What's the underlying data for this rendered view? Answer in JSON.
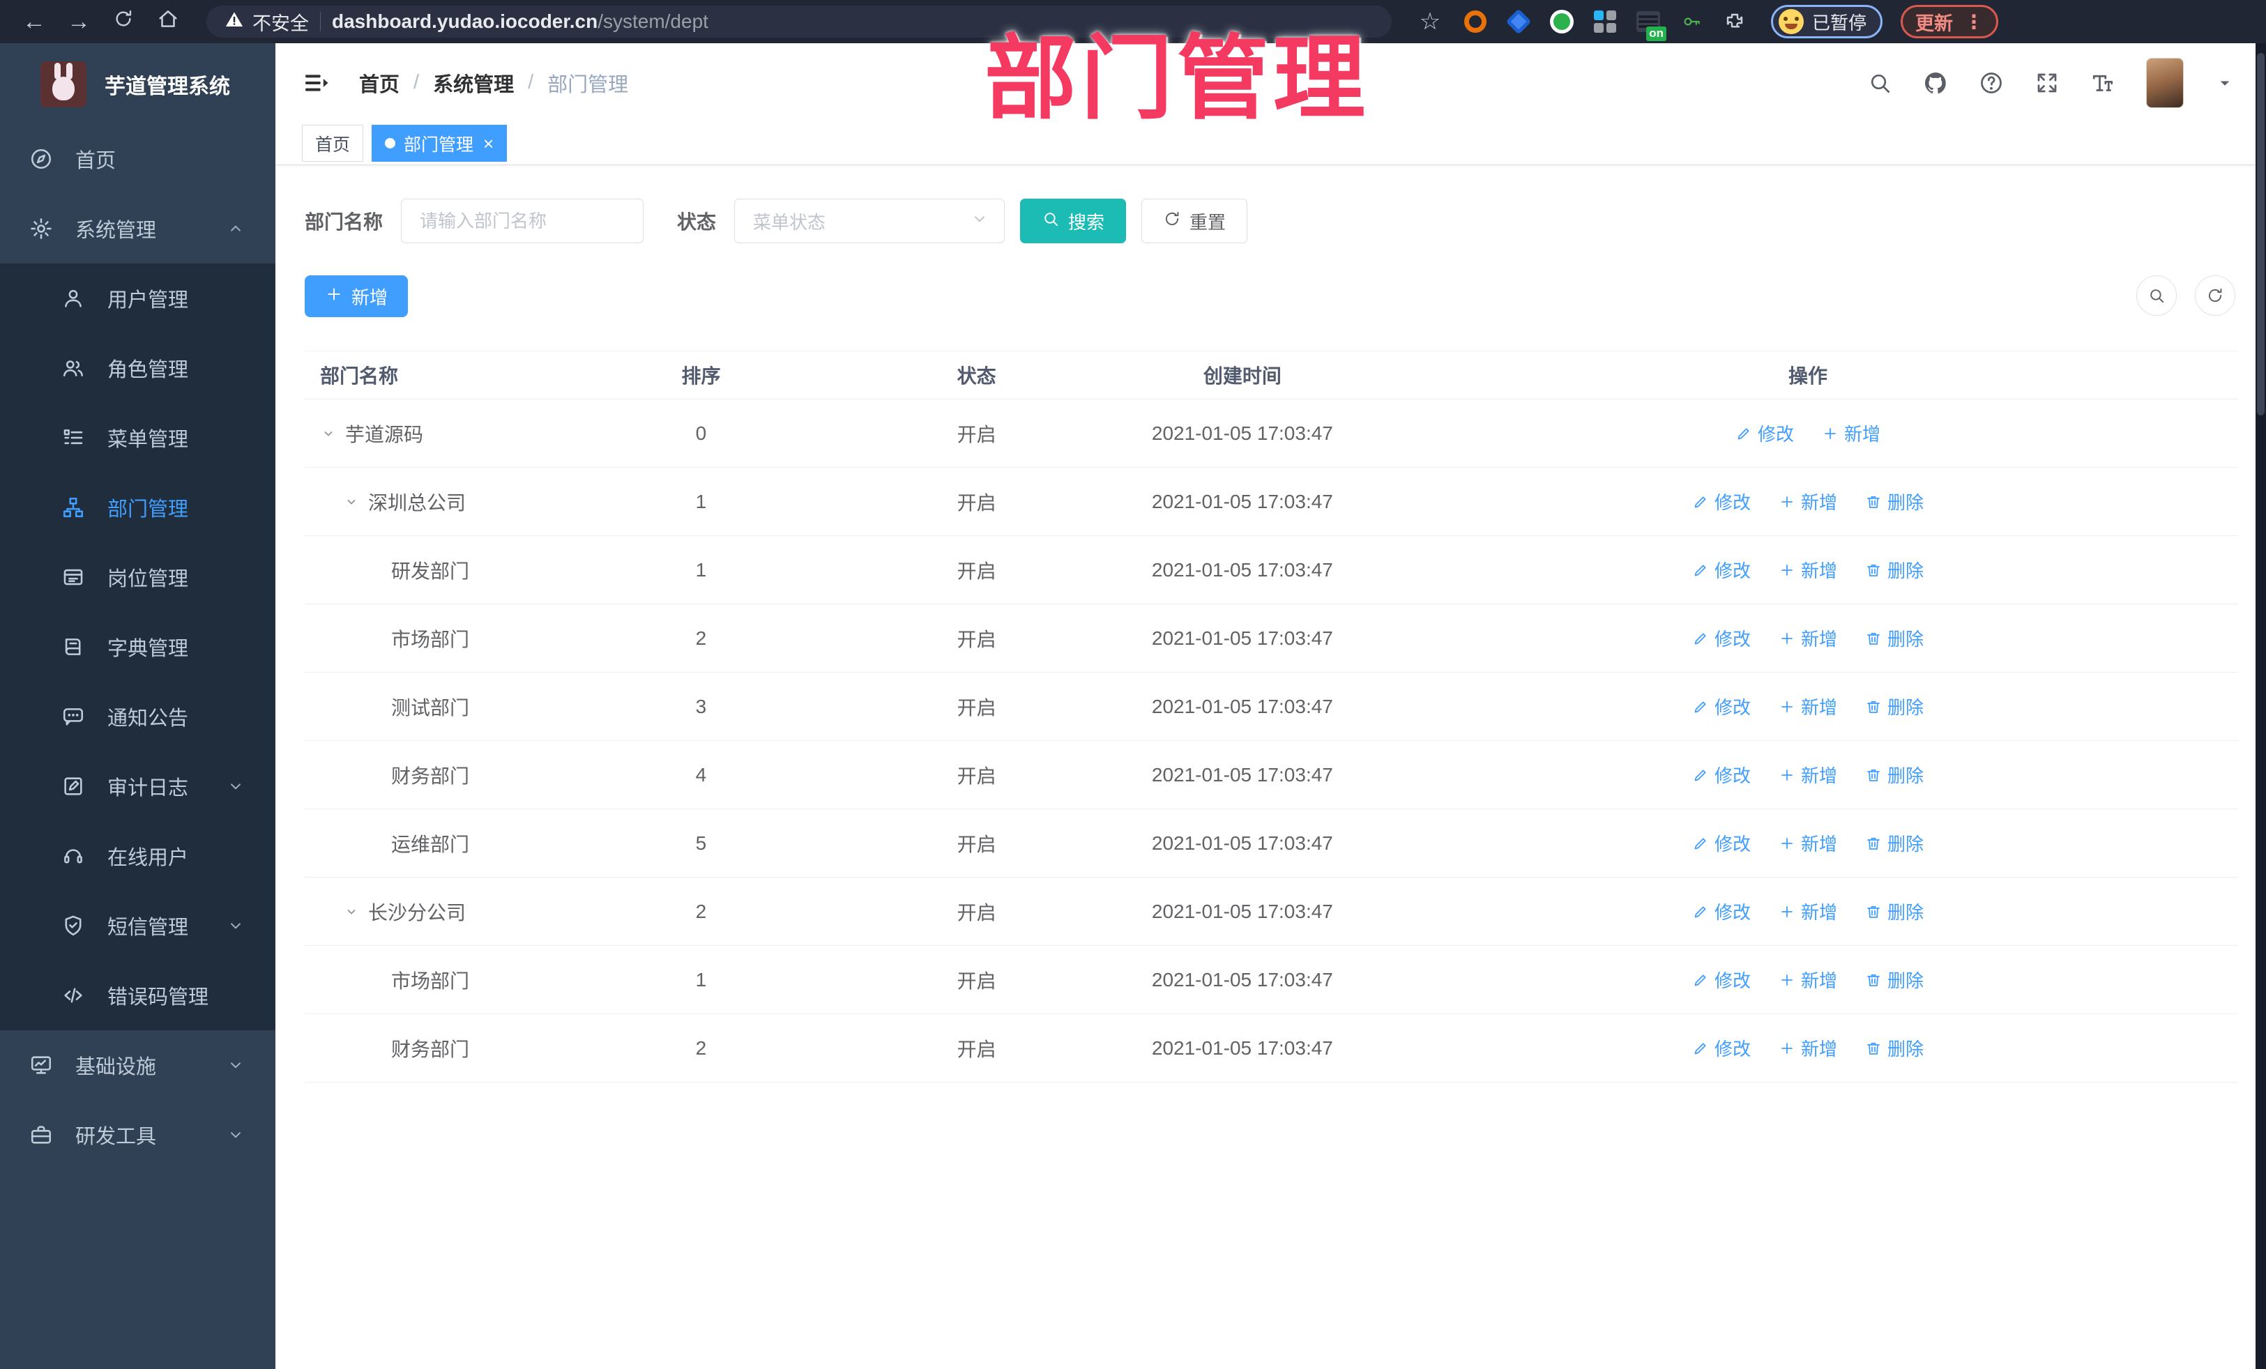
{
  "browser": {
    "security_label": "不安全",
    "url_host": "dashboard.yudao.iocoder.cn",
    "url_path": "/system/dept",
    "ext_badge": "on",
    "profile_label": "已暂停",
    "update_label": "更新",
    "update_menu_glyph": "⋮",
    "star_glyph": "☆",
    "back_glyph": "←",
    "forward_glyph": "→"
  },
  "watermark": "部门管理",
  "sidebar": {
    "title": "芋道管理系统",
    "items": [
      {
        "key": "home",
        "label": "首页",
        "icon": "guide",
        "level": 0
      },
      {
        "key": "system",
        "label": "系统管理",
        "icon": "gear",
        "level": 0,
        "chevron": "up"
      },
      {
        "key": "user",
        "label": "用户管理",
        "icon": "user",
        "level": 1
      },
      {
        "key": "role",
        "label": "角色管理",
        "icon": "users",
        "level": 1
      },
      {
        "key": "menu",
        "label": "菜单管理",
        "icon": "menu",
        "level": 1
      },
      {
        "key": "dept",
        "label": "部门管理",
        "icon": "dept",
        "level": 1,
        "active": true
      },
      {
        "key": "post",
        "label": "岗位管理",
        "icon": "post",
        "level": 1
      },
      {
        "key": "dict",
        "label": "字典管理",
        "icon": "dict",
        "level": 1
      },
      {
        "key": "notice",
        "label": "通知公告",
        "icon": "notice",
        "level": 1
      },
      {
        "key": "log",
        "label": "审计日志",
        "icon": "log",
        "level": 1,
        "chevron": "down"
      },
      {
        "key": "online",
        "label": "在线用户",
        "icon": "online",
        "level": 1
      },
      {
        "key": "sms",
        "label": "短信管理",
        "icon": "sms",
        "level": 1,
        "chevron": "down"
      },
      {
        "key": "errcode",
        "label": "错误码管理",
        "icon": "code",
        "level": 1
      },
      {
        "key": "infra",
        "label": "基础设施",
        "icon": "infra",
        "level": 0,
        "chevron": "down"
      },
      {
        "key": "tools",
        "label": "研发工具",
        "icon": "tools",
        "level": 0,
        "chevron": "down"
      }
    ]
  },
  "header": {
    "breadcrumb": [
      "首页",
      "系统管理",
      "部门管理"
    ],
    "icon_names": [
      "search",
      "github",
      "help",
      "fullscreen",
      "size"
    ]
  },
  "tabs": [
    {
      "label": "首页",
      "active": false,
      "closable": false
    },
    {
      "label": "部门管理",
      "active": true,
      "closable": true,
      "close_glyph": "×"
    }
  ],
  "filters": {
    "name_label": "部门名称",
    "name_placeholder": "请输入部门名称",
    "status_label": "状态",
    "status_placeholder": "菜单状态",
    "search_label": "搜索",
    "reset_label": "重置"
  },
  "toolbar": {
    "add_label": "新增"
  },
  "table": {
    "columns": [
      "部门名称",
      "排序",
      "状态",
      "创建时间",
      "操作"
    ],
    "action_icons": {
      "修改": "edit",
      "新增": "plus",
      "删除": "trash"
    },
    "rows": [
      {
        "name": "芋道源码",
        "level": 0,
        "expandable": true,
        "sort": "0",
        "status": "开启",
        "created": "2021-01-05 17:03:47",
        "actions": [
          "修改",
          "新增"
        ]
      },
      {
        "name": "深圳总公司",
        "level": 1,
        "expandable": true,
        "sort": "1",
        "status": "开启",
        "created": "2021-01-05 17:03:47",
        "actions": [
          "修改",
          "新增",
          "删除"
        ]
      },
      {
        "name": "研发部门",
        "level": 2,
        "expandable": false,
        "sort": "1",
        "status": "开启",
        "created": "2021-01-05 17:03:47",
        "actions": [
          "修改",
          "新增",
          "删除"
        ]
      },
      {
        "name": "市场部门",
        "level": 2,
        "expandable": false,
        "sort": "2",
        "status": "开启",
        "created": "2021-01-05 17:03:47",
        "actions": [
          "修改",
          "新增",
          "删除"
        ]
      },
      {
        "name": "测试部门",
        "level": 2,
        "expandable": false,
        "sort": "3",
        "status": "开启",
        "created": "2021-01-05 17:03:47",
        "actions": [
          "修改",
          "新增",
          "删除"
        ]
      },
      {
        "name": "财务部门",
        "level": 2,
        "expandable": false,
        "sort": "4",
        "status": "开启",
        "created": "2021-01-05 17:03:47",
        "actions": [
          "修改",
          "新增",
          "删除"
        ]
      },
      {
        "name": "运维部门",
        "level": 2,
        "expandable": false,
        "sort": "5",
        "status": "开启",
        "created": "2021-01-05 17:03:47",
        "actions": [
          "修改",
          "新增",
          "删除"
        ]
      },
      {
        "name": "长沙分公司",
        "level": 1,
        "expandable": true,
        "sort": "2",
        "status": "开启",
        "created": "2021-01-05 17:03:47",
        "actions": [
          "修改",
          "新增",
          "删除"
        ]
      },
      {
        "name": "市场部门",
        "level": 2,
        "expandable": false,
        "sort": "1",
        "status": "开启",
        "created": "2021-01-05 17:03:47",
        "actions": [
          "修改",
          "新增",
          "删除"
        ]
      },
      {
        "name": "财务部门",
        "level": 2,
        "expandable": false,
        "sort": "2",
        "status": "开启",
        "created": "2021-01-05 17:03:47",
        "actions": [
          "修改",
          "新增",
          "删除"
        ]
      }
    ]
  },
  "colors": {
    "accent_blue": "#409EFF",
    "search_teal": "#1cbbb4",
    "watermark_pink": "#f43a60",
    "sidebar_bg": "#304156",
    "submenu_bg": "#1f2d3d",
    "chrome_bg": "#202634"
  }
}
